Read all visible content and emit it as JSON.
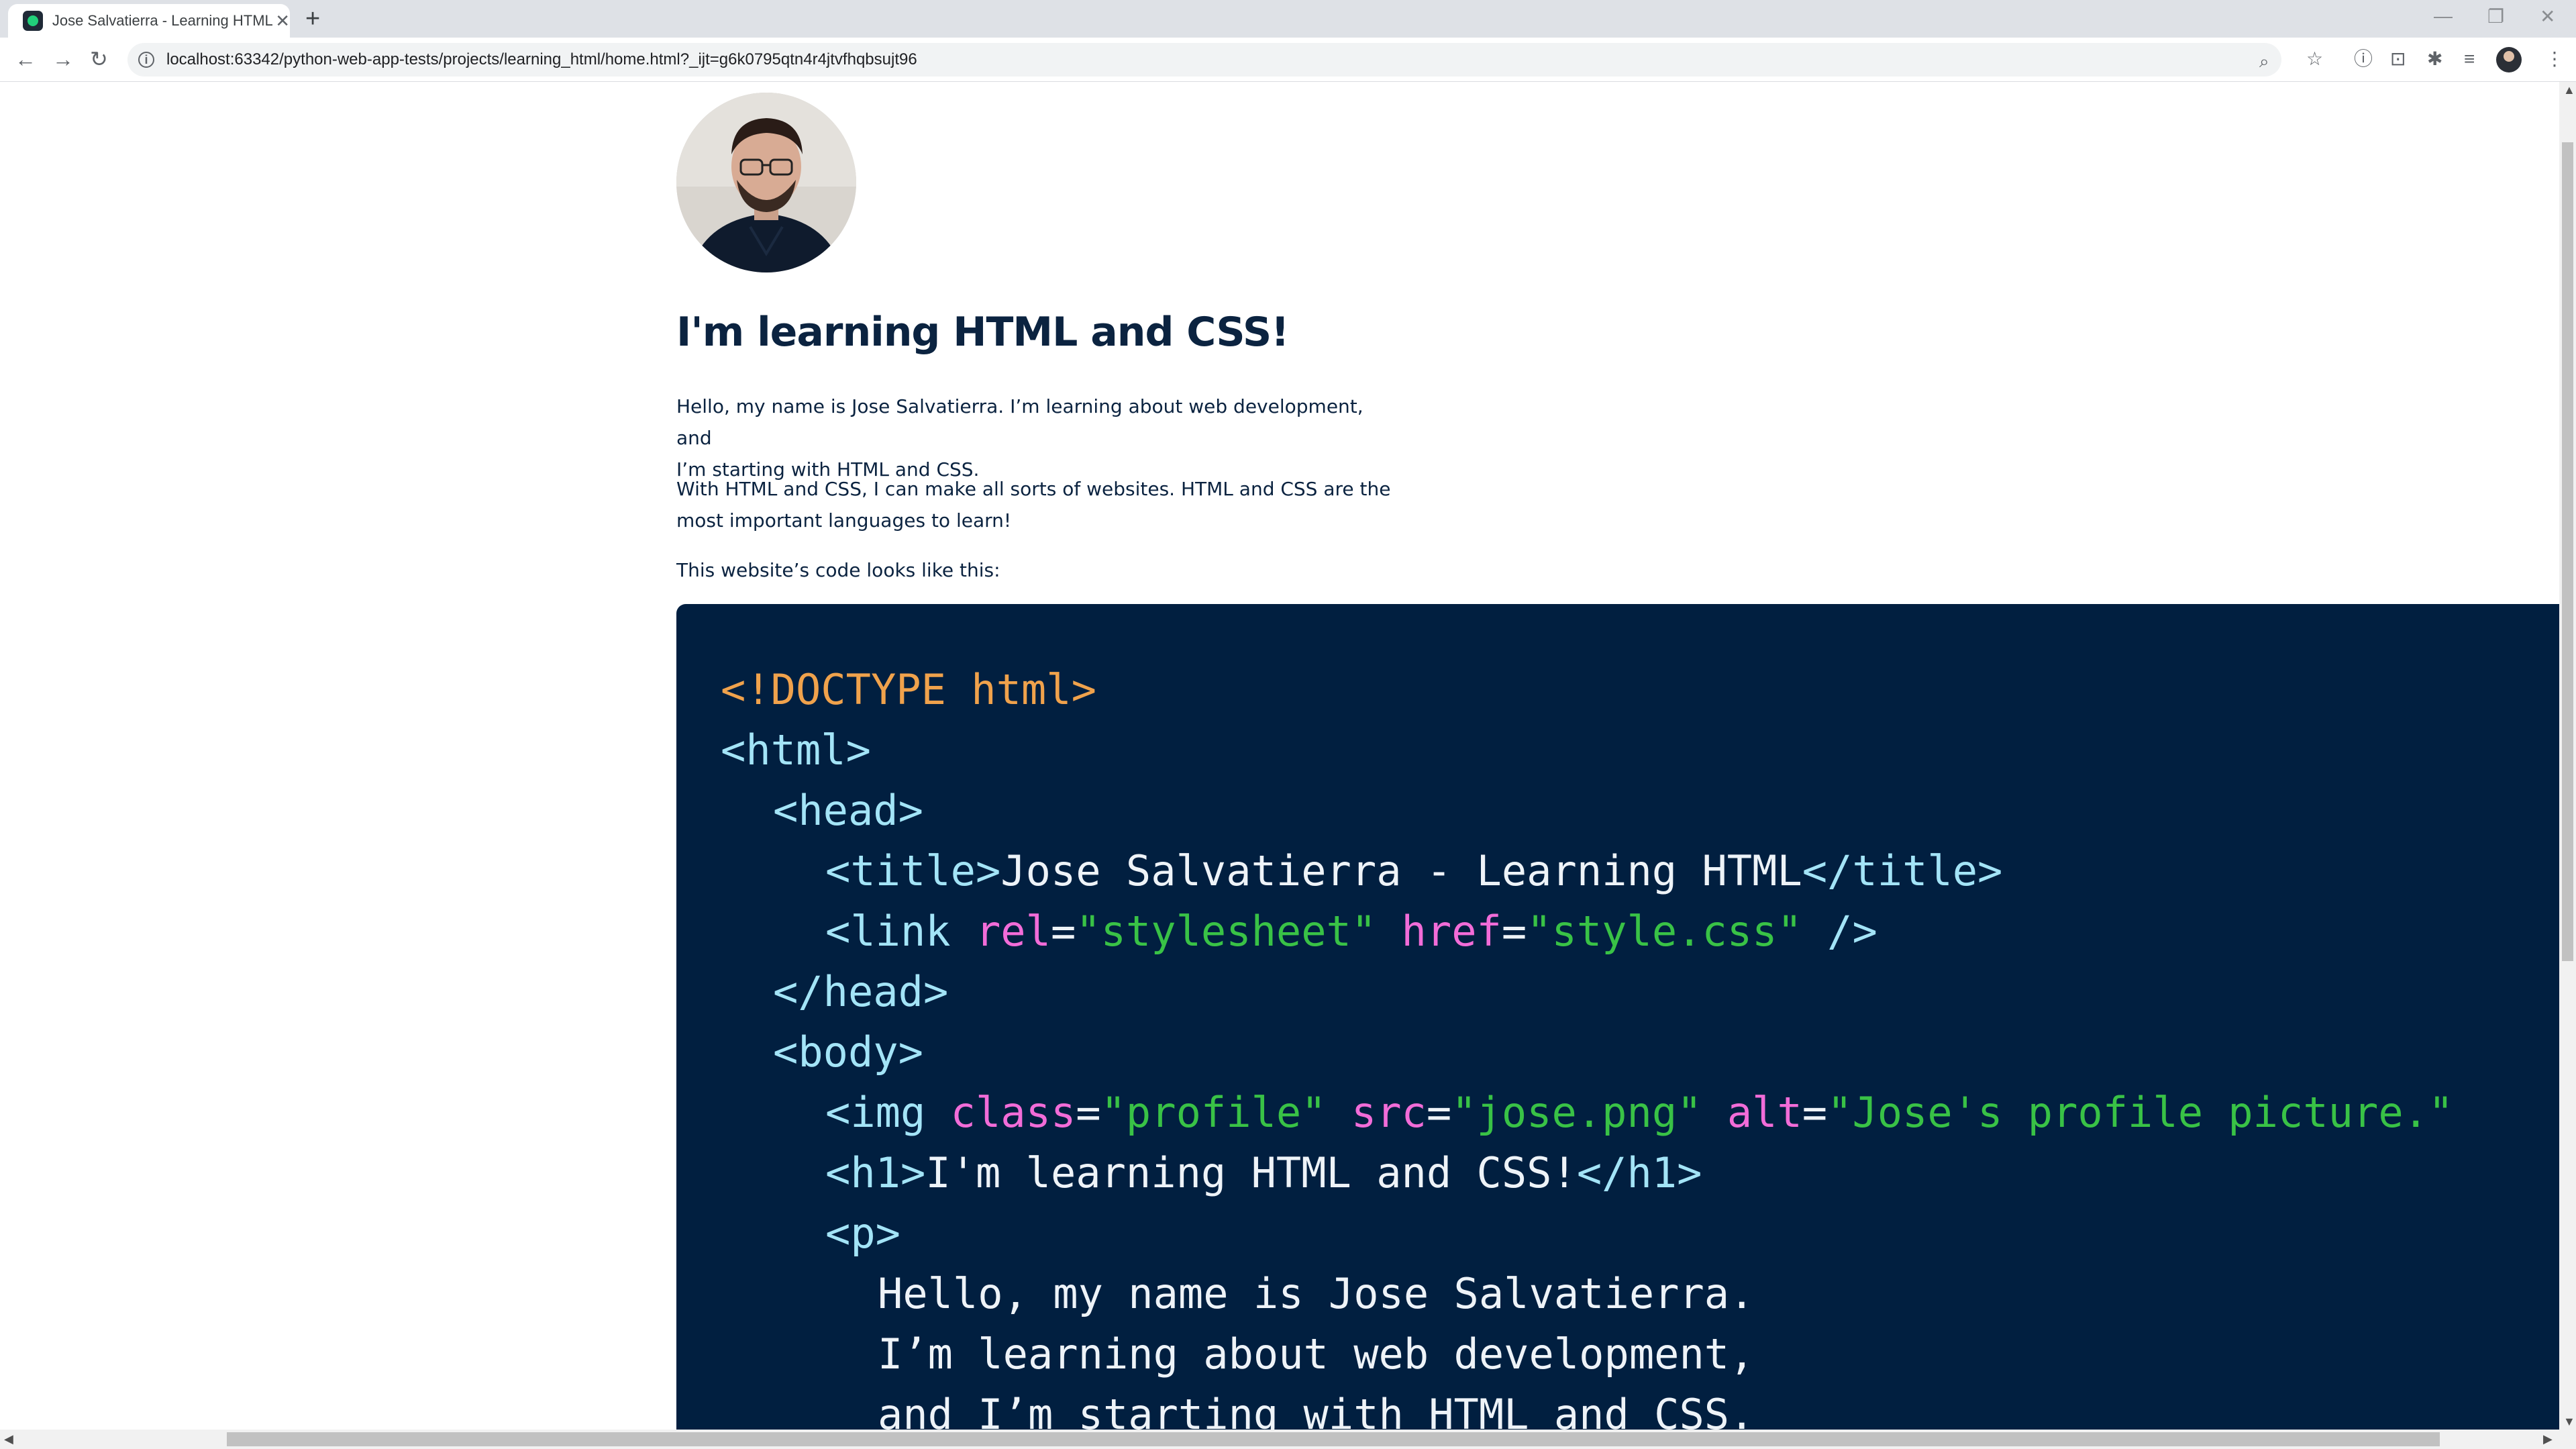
{
  "browser": {
    "tab_title": "Jose Salvatierra - Learning HTML",
    "url": "localhost:63342/python-web-app-tests/projects/learning_html/home.html?_ijt=g6k0795qtn4r4jtvfhqbsujt96"
  },
  "page": {
    "heading": "I'm learning HTML and CSS!",
    "paragraph1_line1": "Hello, my name is Jose Salvatierra. I’m learning about web development, and",
    "paragraph1_line2": "I’m starting with HTML and CSS.",
    "paragraph2_line1": "With HTML and CSS, I can make all sorts of websites. HTML and CSS are the",
    "paragraph2_line2": "most important languages to learn!",
    "paragraph3": "This website’s code looks like this:"
  },
  "code": {
    "l1": "<!DOCTYPE html>",
    "l2": "<html>",
    "l3": "<head>",
    "l4_open": "<title>",
    "l4_text": "Jose Salvatierra - Learning HTML",
    "l4_close": "</title>",
    "l5_tag": "<link",
    "l5_attr1": "rel",
    "l5_eq1": "=",
    "l5_val1": "\"stylesheet\"",
    "l5_attr2": "href",
    "l5_eq2": "=",
    "l5_val2": "\"style.css\"",
    "l5_end": "/>",
    "l6": "</head>",
    "l7": "<body>",
    "l8_tag": "<img",
    "l8_attr1": "class",
    "l8_val1": "\"profile\"",
    "l8_attr2": "src",
    "l8_val2": "\"jose.png\"",
    "l8_attr3": "alt",
    "l8_val3": "\"Jose's profile picture.\"",
    "eq": "=",
    "l9_open": "<h1>",
    "l9_text": "I'm learning HTML and CSS!",
    "l9_close": "</h1>",
    "l10": "<p>",
    "l11": "Hello, my name is Jose Salvatierra.",
    "l12": "I’m learning about web development,",
    "l13": "and I’m starting with HTML and CSS."
  }
}
